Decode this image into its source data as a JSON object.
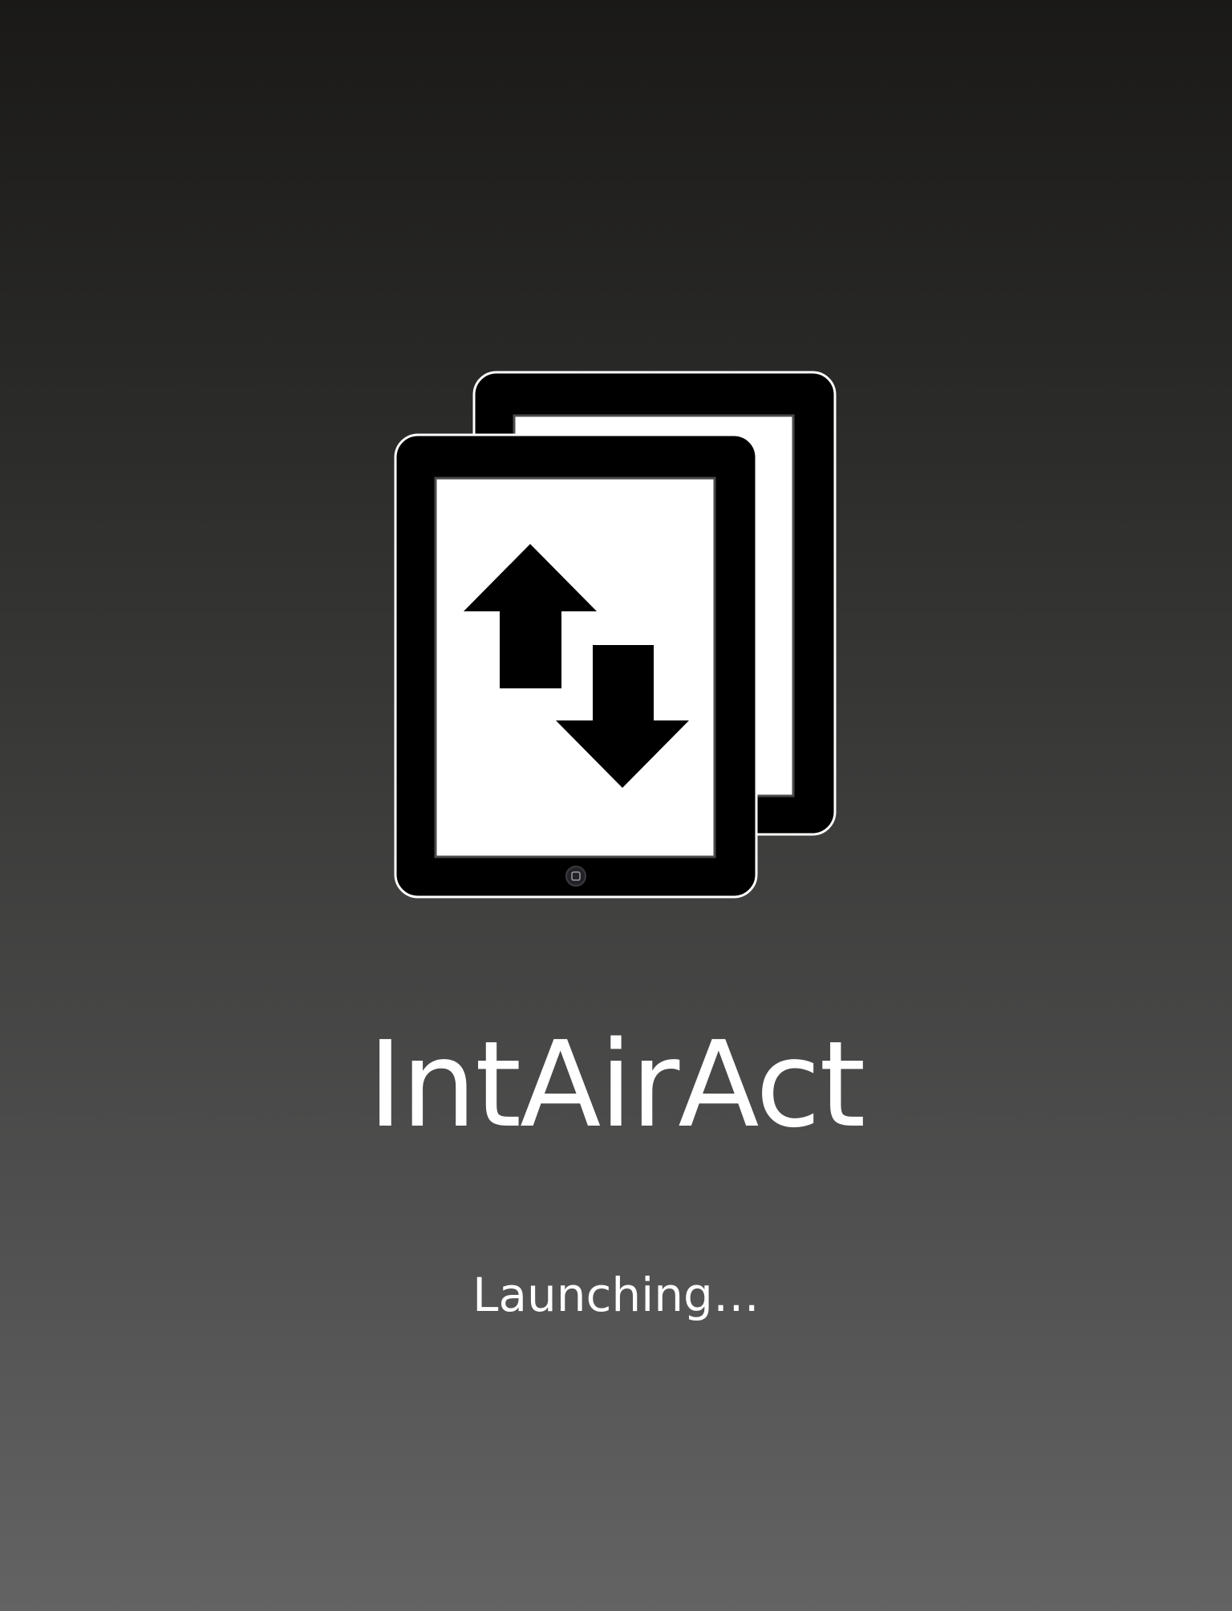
{
  "app": {
    "name": "IntAirAct",
    "status": "Launching…"
  },
  "icons": {
    "logo": "two-tablets-transfer-icon",
    "back_tablet": "tablet-icon",
    "front_tablet": "tablet-icon",
    "up_arrow": "arrow-up-icon",
    "down_arrow": "arrow-down-icon",
    "home_button": "home-button-icon"
  },
  "colors": {
    "background_top": "#1a1918",
    "background_bottom": "#636363",
    "device_body": "#000000",
    "device_outline": "#ffffff",
    "screen": "#ffffff",
    "text": "#ffffff"
  }
}
